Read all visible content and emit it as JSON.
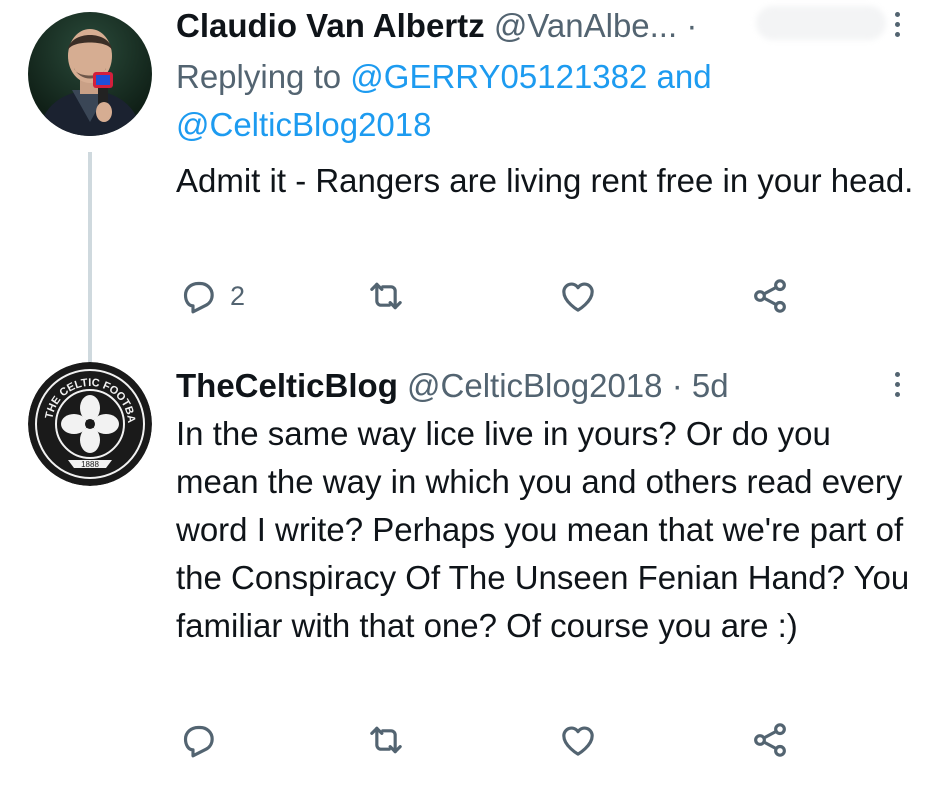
{
  "tweets": [
    {
      "display_name": "Claudio Van Albertz",
      "handle": "@VanAlbe...",
      "separator": "·",
      "replying_label": "Replying to",
      "reply_user_1": "@GERRY05121382",
      "reply_and": "and",
      "reply_user_2": "@CelticBlog2018",
      "text": "Admit it - Rangers are living rent free in your head.",
      "reply_count": "2"
    },
    {
      "display_name": "TheCelticBlog",
      "handle": "@CelticBlog2018",
      "separator": "·",
      "time": "5d",
      "text": "In the same way lice live in yours? Or do you mean the way in which you and others read every word I write? Perhaps you mean that we're part of the Conspiracy Of The Unseen Fenian Hand? You familiar with that one? Of course you are :)",
      "reply_count": "",
      "avatar_badge_text": "THE CELTIC FOOTBALL CLUB",
      "avatar_badge_year": "1888"
    }
  ],
  "icons": [
    "reply-icon",
    "retweet-icon",
    "like-icon",
    "share-icon",
    "more-icon"
  ],
  "colors": {
    "link": "#1d9bf0",
    "secondary": "#536471",
    "primary": "#0f1419",
    "thread_line": "#cfd9de"
  }
}
